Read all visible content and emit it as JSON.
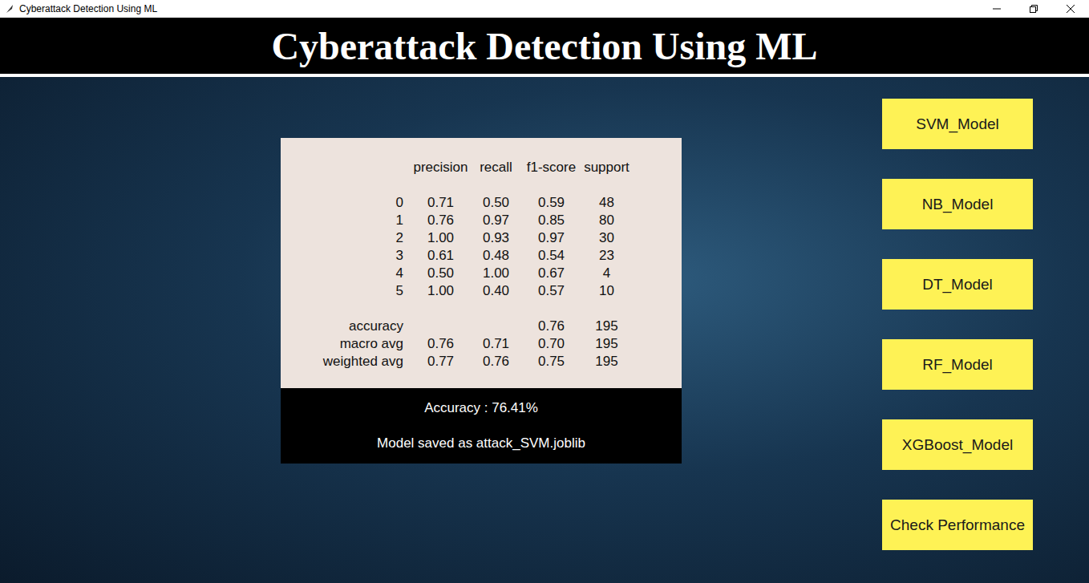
{
  "window": {
    "title": "Cyberattack Detection Using ML"
  },
  "header": {
    "title": "Cyberattack Detection Using ML"
  },
  "report": {
    "columns": [
      "precision",
      "recall",
      "f1-score",
      "support"
    ],
    "classes": [
      {
        "label": "0",
        "values": [
          "0.71",
          "0.50",
          "0.59",
          "48"
        ]
      },
      {
        "label": "1",
        "values": [
          "0.76",
          "0.97",
          "0.85",
          "80"
        ]
      },
      {
        "label": "2",
        "values": [
          "1.00",
          "0.93",
          "0.97",
          "30"
        ]
      },
      {
        "label": "3",
        "values": [
          "0.61",
          "0.48",
          "0.54",
          "23"
        ]
      },
      {
        "label": "4",
        "values": [
          "0.50",
          "1.00",
          "0.67",
          "4"
        ]
      },
      {
        "label": "5",
        "values": [
          "1.00",
          "0.40",
          "0.57",
          "10"
        ]
      }
    ],
    "accuracy": {
      "label": "accuracy",
      "f1_score": "0.76",
      "support": "195"
    },
    "averages": [
      {
        "label": "macro avg",
        "values": [
          "0.76",
          "0.71",
          "0.70",
          "195"
        ]
      },
      {
        "label": "weighted avg",
        "values": [
          "0.77",
          "0.76",
          "0.75",
          "195"
        ]
      }
    ]
  },
  "result": {
    "accuracy": "Accuracy : 76.41%",
    "saved": "Model saved as attack_SVM.joblib"
  },
  "buttons": [
    "SVM_Model",
    "NB_Model",
    "DT_Model",
    "RF_Model",
    "XGBoost_Model",
    "Check Performance"
  ]
}
